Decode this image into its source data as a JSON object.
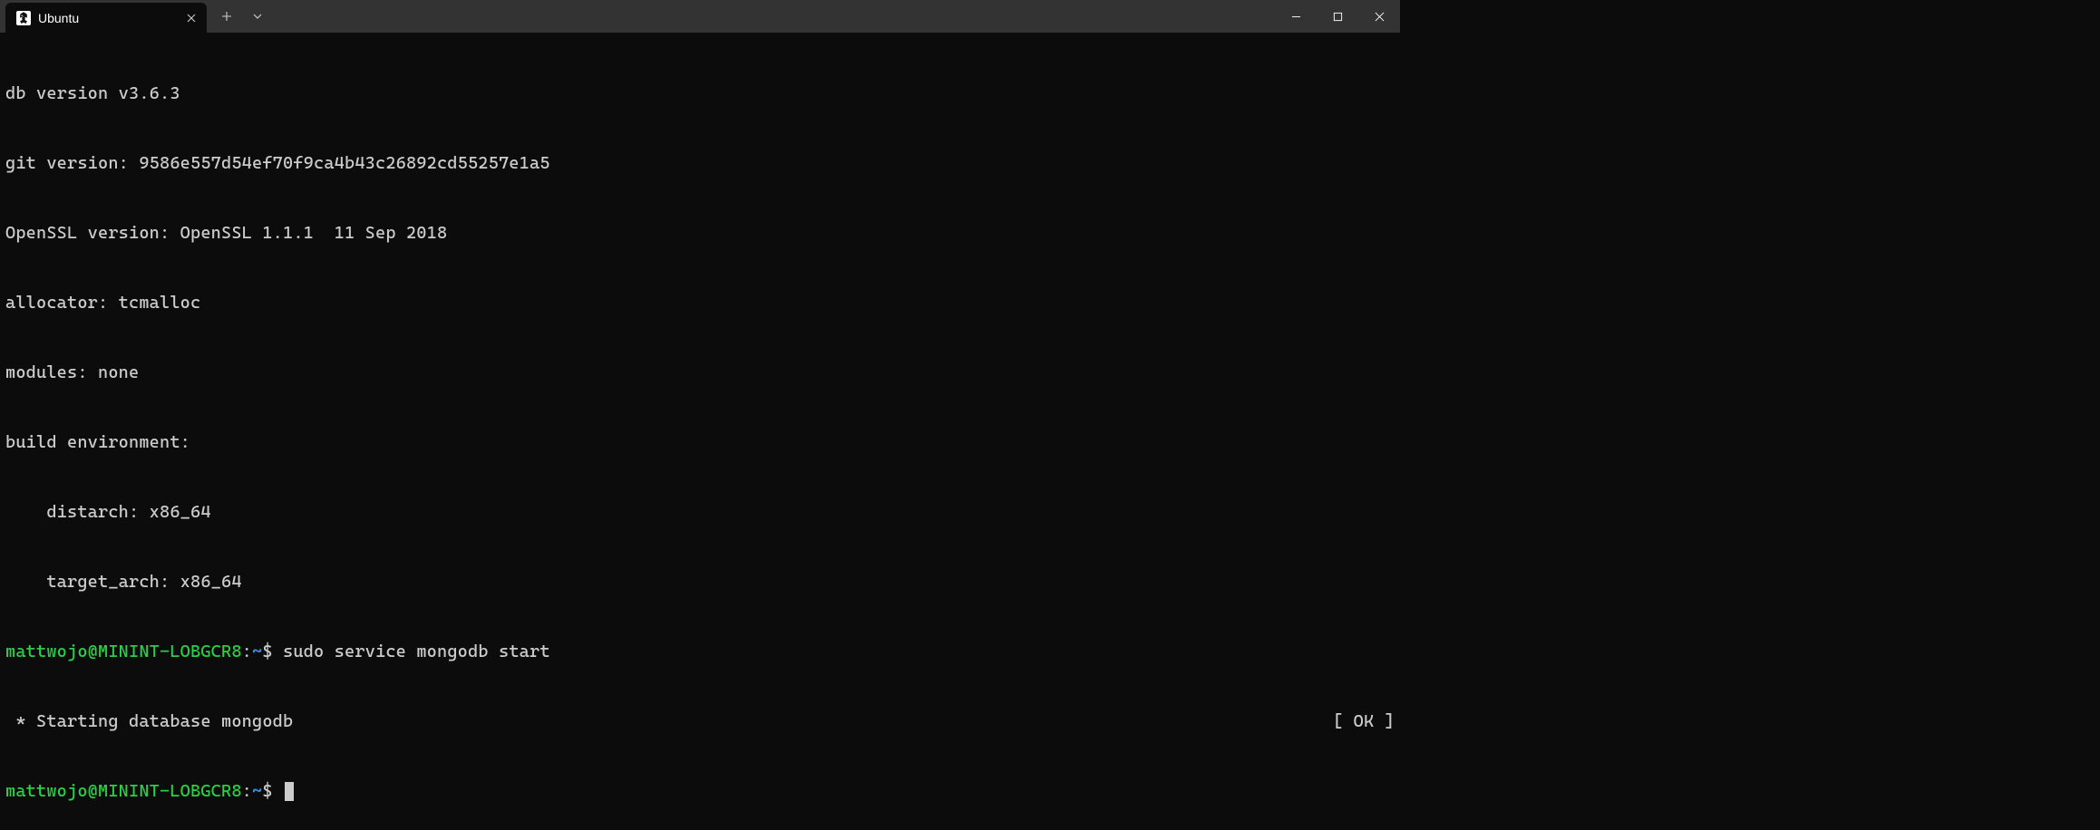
{
  "tab": {
    "title": "Ubuntu"
  },
  "output": {
    "l0": "db version v3.6.3",
    "l1": "git version: 9586e557d54ef70f9ca4b43c26892cd55257e1a5",
    "l2": "OpenSSL version: OpenSSL 1.1.1  11 Sep 2018",
    "l3": "allocator: tcmalloc",
    "l4": "modules: none",
    "l5": "build environment:",
    "l6": "    distarch: x86_64",
    "l7": "    target_arch: x86_64"
  },
  "prompt1": {
    "userhost": "mattwojo@MININT-LOBGCR8",
    "colon": ":",
    "path": "~",
    "dollar": "$ ",
    "command": "sudo service mongodb start"
  },
  "service": {
    "msg": " * Starting database mongodb",
    "status": "[ OK ]"
  },
  "prompt2": {
    "userhost": "mattwojo@MININT-LOBGCR8",
    "colon": ":",
    "path": "~",
    "dollar": "$ "
  }
}
